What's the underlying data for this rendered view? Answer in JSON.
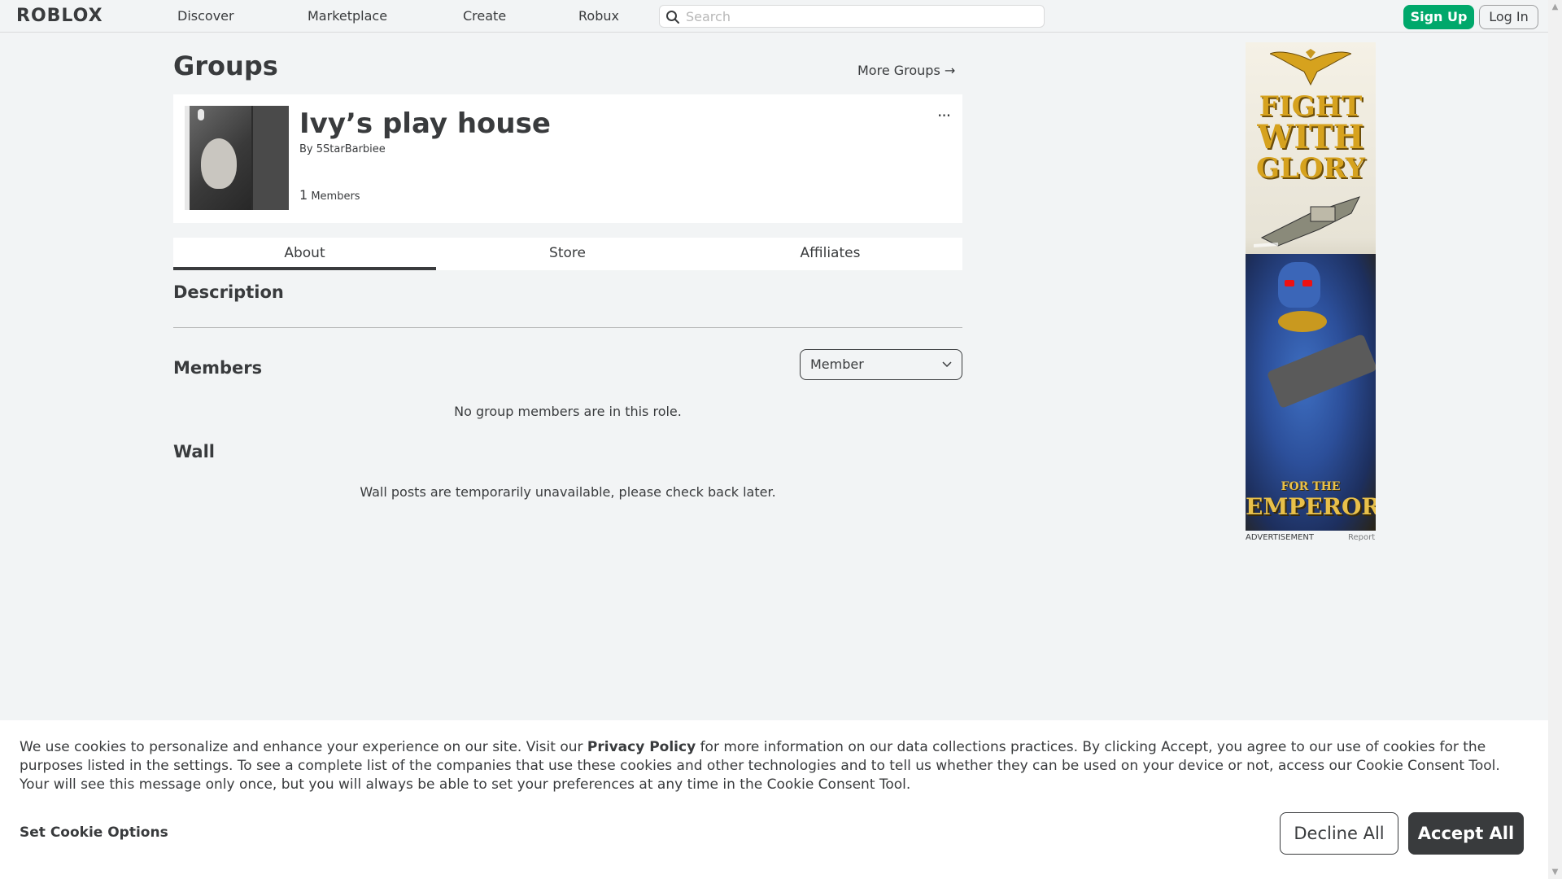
{
  "header": {
    "logo": "ROBLOX",
    "nav": [
      "Discover",
      "Marketplace",
      "Create",
      "Robux"
    ],
    "search_placeholder": "Search",
    "signup_label": "Sign Up",
    "login_label": "Log In"
  },
  "page": {
    "title": "Groups",
    "more_groups": "More Groups →"
  },
  "group": {
    "name": "Ivy’s play house",
    "by_prefix": "By",
    "owner": "5StarBarbiee",
    "member_count": "1",
    "members_label": "Members",
    "more_icon": "..."
  },
  "tabs": [
    "About",
    "Store",
    "Affiliates"
  ],
  "sections": {
    "description_heading": "Description",
    "members_heading": "Members",
    "role_selected": "Member",
    "members_empty": "No group members are in this role.",
    "wall_heading": "Wall",
    "wall_message": "Wall posts are temporarily unavailable, please check back later."
  },
  "ad": {
    "fight": "FIGHT",
    "with": "WITH",
    "glory": "GLORY",
    "for_the": "FOR THE",
    "emperor": "EMPEROR",
    "label": "ADVERTISEMENT",
    "report": "Report"
  },
  "cookie": {
    "text_before": "We use cookies to personalize and enhance your experience on our site. Visit our ",
    "link": "Privacy Policy",
    "text_after": " for more information on our data collections practices. By clicking Accept, you agree to our use of cookies for the purposes listed in the settings. To see a complete list of the companies that use these cookies and other technologies and to tell us whether they can be used on your device or not, access our Cookie Consent Tool. Your will see this message only once, but you will always be able to set your preferences at any time in the Cookie Consent Tool.",
    "options": "Set Cookie Options",
    "decline": "Decline All",
    "accept": "Accept All"
  },
  "colors": {
    "background": "#f2f4f5",
    "signup_green": "#00a86b",
    "text": "#393b3d"
  },
  "icons": [
    "search-icon",
    "arrow-right-icon",
    "more-dots-icon",
    "chevron-down-icon"
  ]
}
